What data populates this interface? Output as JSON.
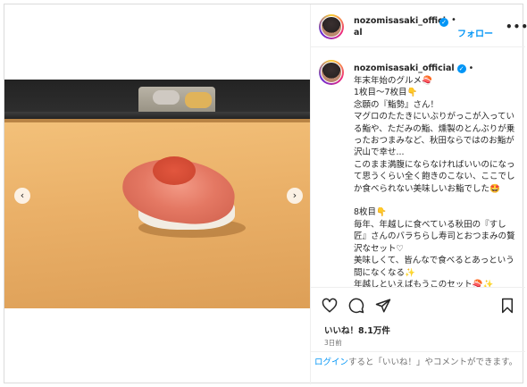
{
  "header": {
    "username_line1": "nozomisasaki_offici",
    "username_line2": "al",
    "dot": "•",
    "follow_label": "フォロー",
    "more_label": "•••"
  },
  "caption": {
    "username": "nozomisasaki_official",
    "dot": "•",
    "lines": [
      "年末年始のグルメ🍣",
      "1枚目〜7枚目👇",
      "念願の『鮨勢』さん！",
      "マグロのたたきにいぶりがっこが入っている鮨や、ただみの鮨、燻製のとんぶりが乗ったおつまみなど、秋田ならではのお鮨が沢山で幸せ...",
      "このまま満腹にならなければいいのになって思うくらい全く飽きのこない、ここでしか食べられない美味しいお鮨でした🤩",
      "",
      "8枚目👇",
      "毎年、年越しに食べている秋田の『すし匠』さんのバラちらし寿司とおつまみの贅沢なセット♡",
      "美味しくて、皆んなで食べるとあっという間になくなる✨",
      "年越しといえばもうこのセット🍣✨"
    ]
  },
  "media": {
    "prev_label": "‹",
    "next_label": "›"
  },
  "footer": {
    "likes": "いいね！8.1万件",
    "time": "3日前",
    "login_link": "ログイン",
    "login_rest": "すると「いいね！」やコメントができます。"
  },
  "colors": {
    "accent": "#0095f6",
    "text": "#262626",
    "muted": "#737373"
  },
  "icons": [
    "heart-icon",
    "comment-icon",
    "share-icon",
    "bookmark-icon",
    "verified-icon"
  ]
}
